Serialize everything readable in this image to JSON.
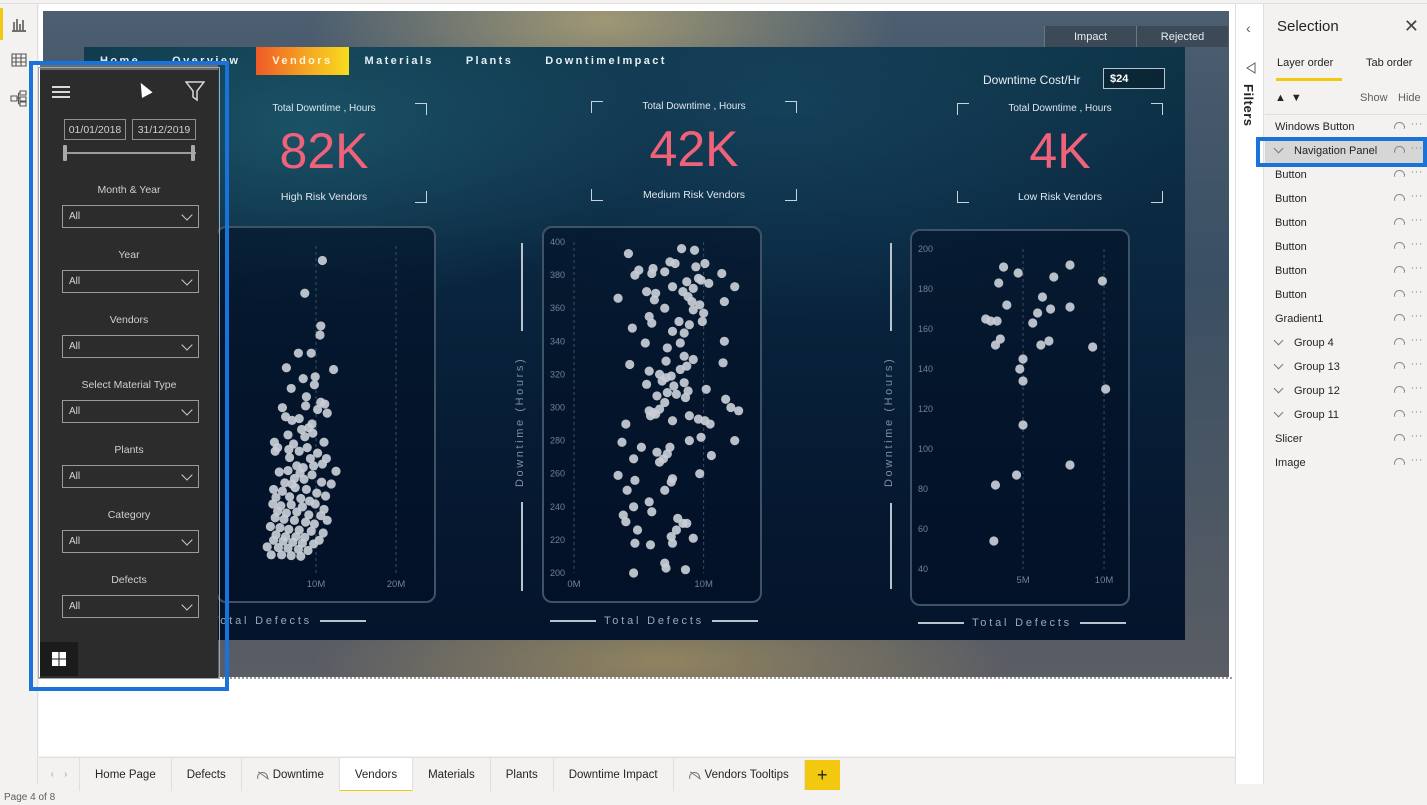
{
  "view_rail": {
    "items": [
      {
        "name": "report-view",
        "icon": "bar-chart-icon",
        "active": true
      },
      {
        "name": "data-view",
        "icon": "table-grid-icon",
        "active": false
      },
      {
        "name": "model-view",
        "icon": "model-diagram-icon",
        "active": false
      }
    ]
  },
  "dashboard": {
    "nav": [
      {
        "label": "Home",
        "active": false
      },
      {
        "label": "Overview",
        "active": false
      },
      {
        "label": "Vendors",
        "active": true
      },
      {
        "label": "Materials",
        "active": false
      },
      {
        "label": "Plants",
        "active": false
      },
      {
        "label": "DowntimeImpact",
        "active": false
      }
    ],
    "toggle_tabs": [
      "Impact",
      "Rejected"
    ],
    "cost_label": "Downtime Cost/Hr",
    "cost_value": "$24",
    "accent_color": "#f0617a",
    "kpis": [
      {
        "title": "Total Downtime , Hours",
        "value": "82K",
        "subtitle": "High Risk Vendors"
      },
      {
        "title": "Total Downtime , Hours",
        "value": "42K",
        "subtitle": "Medium Risk Vendors"
      },
      {
        "title": "Total Downtime , Hours",
        "value": "4K",
        "subtitle": "Low Risk Vendors"
      }
    ],
    "y_axis_title": "Downtime (Hours)",
    "x_axis_title": "Total Defects"
  },
  "chart_data": [
    {
      "type": "scatter",
      "title": "High Risk Vendors",
      "xlabel": "Total Defects",
      "ylabel": "Downtime (Hours)",
      "xlim": [
        0,
        22000000
      ],
      "ylim": [
        600,
        1500
      ],
      "x_ticks": [
        {
          "v": 10000000,
          "label": "10M"
        },
        {
          "v": 20000000,
          "label": "20M"
        }
      ],
      "y_ticks": [],
      "grid": true,
      "points": [
        [
          10.8,
          1460
        ],
        [
          8.6,
          1370
        ],
        [
          10.6,
          1280
        ],
        [
          10.5,
          1255
        ],
        [
          7.8,
          1205
        ],
        [
          9.4,
          1205
        ],
        [
          6.3,
          1165
        ],
        [
          12.2,
          1160
        ],
        [
          8.4,
          1135
        ],
        [
          9.9,
          1140
        ],
        [
          9.8,
          1118
        ],
        [
          6.9,
          1108
        ],
        [
          8.8,
          1085
        ],
        [
          10.6,
          1070
        ],
        [
          11.1,
          1065
        ],
        [
          5.8,
          1055
        ],
        [
          8.7,
          1060
        ],
        [
          10.2,
          1050
        ],
        [
          11.4,
          1040
        ],
        [
          6.2,
          1030
        ],
        [
          7.0,
          1020
        ],
        [
          7.9,
          1025
        ],
        [
          9.5,
          1010
        ],
        [
          8.2,
          995
        ],
        [
          9.1,
          1000
        ],
        [
          4.8,
          960
        ],
        [
          6.5,
          980
        ],
        [
          8.6,
          975
        ],
        [
          9.6,
          985
        ],
        [
          11.0,
          960
        ],
        [
          5.2,
          945
        ],
        [
          7.2,
          955
        ],
        [
          4.9,
          935
        ],
        [
          6.6,
          940
        ],
        [
          7.9,
          935
        ],
        [
          8.9,
          945
        ],
        [
          10.2,
          930
        ],
        [
          6.7,
          918
        ],
        [
          9.3,
          915
        ],
        [
          11.3,
          915
        ],
        [
          7.6,
          895
        ],
        [
          8.4,
          890
        ],
        [
          9.7,
          895
        ],
        [
          10.8,
          900
        ],
        [
          12.5,
          880
        ],
        [
          5.4,
          878
        ],
        [
          6.5,
          882
        ],
        [
          8.0,
          875
        ],
        [
          9.5,
          870
        ],
        [
          7.3,
          860
        ],
        [
          8.5,
          858
        ],
        [
          6.1,
          848
        ],
        [
          7.0,
          845
        ],
        [
          10.7,
          850
        ],
        [
          11.9,
          845
        ],
        [
          4.7,
          830
        ],
        [
          5.8,
          825
        ],
        [
          7.4,
          835
        ],
        [
          8.8,
          830
        ],
        [
          10.1,
          820
        ],
        [
          11.2,
          812
        ],
        [
          5.0,
          808
        ],
        [
          6.7,
          810
        ],
        [
          8.1,
          805
        ],
        [
          9.2,
          798
        ],
        [
          4.6,
          790
        ],
        [
          5.6,
          785
        ],
        [
          6.9,
          788
        ],
        [
          8.3,
          782
        ],
        [
          9.9,
          790
        ],
        [
          11.0,
          775
        ],
        [
          5.2,
          770
        ],
        [
          6.3,
          765
        ],
        [
          7.6,
          768
        ],
        [
          9.1,
          760
        ],
        [
          10.6,
          758
        ],
        [
          4.9,
          752
        ],
        [
          6.0,
          748
        ],
        [
          7.3,
          745
        ],
        [
          8.7,
          740
        ],
        [
          9.8,
          735
        ],
        [
          11.4,
          745
        ],
        [
          4.3,
          728
        ],
        [
          5.5,
          725
        ],
        [
          6.6,
          720
        ],
        [
          7.9,
          718
        ],
        [
          9.4,
          715
        ],
        [
          10.9,
          710
        ],
        [
          5.0,
          705
        ],
        [
          6.2,
          700
        ],
        [
          7.5,
          700
        ],
        [
          8.6,
          698
        ],
        [
          4.7,
          690
        ],
        [
          5.9,
          688
        ],
        [
          7.1,
          685
        ],
        [
          8.3,
          682
        ],
        [
          9.7,
          680
        ],
        [
          10.4,
          690
        ],
        [
          3.9,
          672
        ],
        [
          5.3,
          670
        ],
        [
          6.5,
          668
        ],
        [
          7.8,
          665
        ],
        [
          9.0,
          662
        ],
        [
          4.4,
          650
        ],
        [
          5.7,
          650
        ],
        [
          6.9,
          648
        ],
        [
          8.1,
          646
        ]
      ]
    },
    {
      "type": "scatter",
      "title": "Medium Risk Vendors",
      "xlabel": "Total Defects",
      "ylabel": "Downtime (Hours)",
      "xlim": [
        0,
        13500000
      ],
      "ylim": [
        200,
        400
      ],
      "x_ticks": [
        {
          "v": 0,
          "label": "0M"
        },
        {
          "v": 10000000,
          "label": "10M"
        }
      ],
      "y_ticks": [
        200,
        220,
        240,
        260,
        280,
        300,
        320,
        340,
        360,
        380,
        400
      ],
      "grid": true,
      "points": [
        [
          4.2,
          393
        ],
        [
          8.3,
          396
        ],
        [
          9.3,
          395
        ],
        [
          5.0,
          383
        ],
        [
          4.7,
          380
        ],
        [
          6.1,
          384
        ],
        [
          6.0,
          381
        ],
        [
          7.0,
          382
        ],
        [
          7.4,
          388
        ],
        [
          7.8,
          387
        ],
        [
          9.4,
          385
        ],
        [
          9.6,
          378
        ],
        [
          10.1,
          387
        ],
        [
          11.4,
          381
        ],
        [
          8.7,
          376
        ],
        [
          9.2,
          372
        ],
        [
          9.8,
          377
        ],
        [
          10.4,
          375
        ],
        [
          12.4,
          373
        ],
        [
          3.4,
          366
        ],
        [
          5.6,
          370
        ],
        [
          6.3,
          369
        ],
        [
          6.2,
          365
        ],
        [
          7.6,
          373
        ],
        [
          8.4,
          370
        ],
        [
          8.8,
          367
        ],
        [
          9.1,
          364
        ],
        [
          9.7,
          362
        ],
        [
          11.6,
          364
        ],
        [
          7.0,
          360
        ],
        [
          9.2,
          359
        ],
        [
          10.0,
          357
        ],
        [
          5.8,
          355
        ],
        [
          6.0,
          351
        ],
        [
          4.5,
          348
        ],
        [
          8.1,
          352
        ],
        [
          8.9,
          350
        ],
        [
          9.9,
          352
        ],
        [
          7.6,
          346
        ],
        [
          8.5,
          345
        ],
        [
          5.5,
          339
        ],
        [
          7.2,
          336
        ],
        [
          8.2,
          339
        ],
        [
          11.6,
          340
        ],
        [
          7.1,
          328
        ],
        [
          8.5,
          331
        ],
        [
          9.2,
          329
        ],
        [
          8.7,
          325
        ],
        [
          4.3,
          326
        ],
        [
          5.8,
          322
        ],
        [
          11.5,
          327
        ],
        [
          6.6,
          320
        ],
        [
          7.1,
          318
        ],
        [
          7.5,
          319
        ],
        [
          8.2,
          323
        ],
        [
          5.6,
          314
        ],
        [
          6.8,
          316
        ],
        [
          7.7,
          313
        ],
        [
          8.5,
          315
        ],
        [
          7.2,
          309
        ],
        [
          7.9,
          308
        ],
        [
          8.8,
          310
        ],
        [
          6.4,
          307
        ],
        [
          8.6,
          306
        ],
        [
          10.2,
          311
        ],
        [
          11.7,
          305
        ],
        [
          12.1,
          300
        ],
        [
          7.0,
          303
        ],
        [
          5.8,
          298
        ],
        [
          6.1,
          297
        ],
        [
          6.6,
          299
        ],
        [
          5.9,
          295
        ],
        [
          6.3,
          296
        ],
        [
          8.9,
          295
        ],
        [
          9.6,
          293
        ],
        [
          10.1,
          292
        ],
        [
          10.5,
          290
        ],
        [
          12.7,
          298
        ],
        [
          4.0,
          290
        ],
        [
          7.6,
          292
        ],
        [
          3.7,
          279
        ],
        [
          5.2,
          276
        ],
        [
          6.4,
          273
        ],
        [
          7.4,
          276
        ],
        [
          6.9,
          269
        ],
        [
          7.2,
          272
        ],
        [
          8.9,
          280
        ],
        [
          9.8,
          282
        ],
        [
          10.6,
          271
        ],
        [
          12.4,
          280
        ],
        [
          4.6,
          269
        ],
        [
          6.6,
          267
        ],
        [
          3.4,
          259
        ],
        [
          4.7,
          256
        ],
        [
          7.6,
          257
        ],
        [
          9.7,
          260
        ],
        [
          7.5,
          255
        ],
        [
          4.1,
          250
        ],
        [
          7.0,
          250
        ],
        [
          5.8,
          243
        ],
        [
          4.6,
          240
        ],
        [
          6.0,
          237
        ],
        [
          3.8,
          235
        ],
        [
          4.0,
          231
        ],
        [
          8.0,
          233
        ],
        [
          8.4,
          230
        ],
        [
          7.9,
          226
        ],
        [
          8.7,
          230
        ],
        [
          4.9,
          226
        ],
        [
          7.5,
          222
        ],
        [
          7.6,
          218
        ],
        [
          9.2,
          221
        ],
        [
          4.7,
          218
        ],
        [
          5.9,
          217
        ],
        [
          7.0,
          206
        ],
        [
          7.1,
          203
        ],
        [
          8.6,
          202
        ],
        [
          4.6,
          200
        ]
      ]
    },
    {
      "type": "scatter",
      "title": "Low Risk Vendors",
      "xlabel": "Total Defects",
      "ylabel": "Downtime (Hours)",
      "xlim": [
        0,
        10800000
      ],
      "ylim": [
        40,
        200
      ],
      "x_ticks": [
        {
          "v": 5000000,
          "label": "5M"
        },
        {
          "v": 10000000,
          "label": "10M"
        }
      ],
      "y_ticks": [
        40,
        60,
        80,
        100,
        120,
        140,
        160,
        180,
        200
      ],
      "grid": true,
      "points": [
        [
          3.8,
          191
        ],
        [
          4.7,
          188
        ],
        [
          3.5,
          183
        ],
        [
          7.9,
          192
        ],
        [
          6.9,
          186
        ],
        [
          9.9,
          184
        ],
        [
          4.0,
          172
        ],
        [
          6.2,
          176
        ],
        [
          5.9,
          168
        ],
        [
          6.7,
          170
        ],
        [
          7.9,
          171
        ],
        [
          2.7,
          165
        ],
        [
          3.0,
          164
        ],
        [
          3.4,
          164
        ],
        [
          5.6,
          163
        ],
        [
          3.6,
          155
        ],
        [
          3.3,
          152
        ],
        [
          6.1,
          152
        ],
        [
          6.6,
          154
        ],
        [
          9.3,
          151
        ],
        [
          5.0,
          145
        ],
        [
          4.8,
          140
        ],
        [
          5.0,
          134
        ],
        [
          10.1,
          130
        ],
        [
          5.0,
          112
        ],
        [
          7.9,
          92
        ],
        [
          4.6,
          87
        ],
        [
          3.3,
          82
        ],
        [
          3.2,
          54
        ]
      ]
    }
  ],
  "nav_panel": {
    "date_start": "01/01/2018",
    "date_end": "31/12/2019",
    "date_range_fraction": [
      0,
      1
    ],
    "slicers": [
      {
        "label": "Month & Year",
        "value": "All"
      },
      {
        "label": "Year",
        "value": "All"
      },
      {
        "label": "Vendors",
        "value": "All"
      },
      {
        "label": "Select Material Type",
        "value": "All"
      },
      {
        "label": "Plants",
        "value": "All"
      },
      {
        "label": "Category",
        "value": "All"
      },
      {
        "label": "Defects",
        "value": "All"
      }
    ]
  },
  "filters_pane": {
    "label": "Filters"
  },
  "selection_pane": {
    "title": "Selection",
    "tabs": [
      {
        "label": "Layer order",
        "active": true
      },
      {
        "label": "Tab order",
        "active": false
      }
    ],
    "show_label": "Show",
    "hide_label": "Hide",
    "layers": [
      {
        "name": "Windows Button",
        "group": false,
        "selected": false
      },
      {
        "name": "Navigation Panel",
        "group": true,
        "selected": true
      },
      {
        "name": "Button",
        "group": false,
        "selected": false
      },
      {
        "name": "Button",
        "group": false,
        "selected": false
      },
      {
        "name": "Button",
        "group": false,
        "selected": false
      },
      {
        "name": "Button",
        "group": false,
        "selected": false
      },
      {
        "name": "Button",
        "group": false,
        "selected": false
      },
      {
        "name": "Button",
        "group": false,
        "selected": false
      },
      {
        "name": "Gradient1",
        "group": false,
        "selected": false
      },
      {
        "name": "Group 4",
        "group": true,
        "selected": false
      },
      {
        "name": "Group 13",
        "group": true,
        "selected": false
      },
      {
        "name": "Group 12",
        "group": true,
        "selected": false
      },
      {
        "name": "Group 11",
        "group": true,
        "selected": false
      },
      {
        "name": "Slicer",
        "group": false,
        "selected": false
      },
      {
        "name": "Image",
        "group": false,
        "selected": false
      }
    ]
  },
  "page_tabs": [
    {
      "label": "Home Page",
      "hidden": false,
      "active": false
    },
    {
      "label": "Defects",
      "hidden": false,
      "active": false
    },
    {
      "label": "Downtime",
      "hidden": true,
      "active": false
    },
    {
      "label": "Vendors",
      "hidden": false,
      "active": true
    },
    {
      "label": "Materials",
      "hidden": false,
      "active": false
    },
    {
      "label": "Plants",
      "hidden": false,
      "active": false
    },
    {
      "label": "Downtime Impact",
      "hidden": false,
      "active": false
    },
    {
      "label": "Vendors Tooltips",
      "hidden": true,
      "active": false
    }
  ],
  "add_page_label": "+",
  "status": {
    "page_indicator": "Page 4 of 8"
  }
}
